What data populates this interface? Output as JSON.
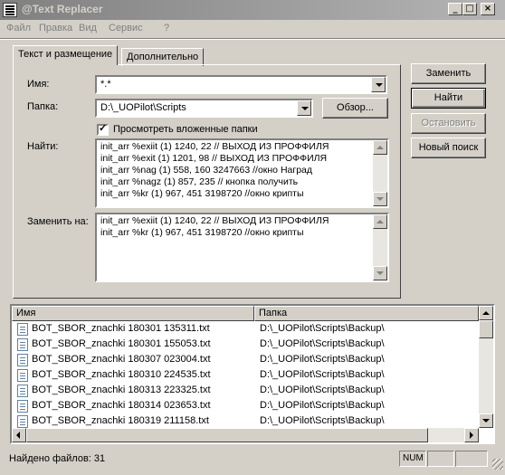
{
  "window": {
    "title": "@Text Replacer"
  },
  "menu": [
    "Файл",
    "Правка",
    "Вид",
    "Сервис",
    "?"
  ],
  "tabs": [
    {
      "label": "Текст и размещение",
      "active": true
    },
    {
      "label": "Дополнительно",
      "active": false
    }
  ],
  "form": {
    "name_label": "Имя:",
    "name_value": "*.*",
    "folder_label": "Папка:",
    "folder_value": "D:\\_UOPilot\\Scripts",
    "browse_button": "Обзор...",
    "subfolders_label": "Просмотреть вложенные папки",
    "subfolders_checked": true,
    "find_label": "Найти:",
    "find_lines": [
      "init_arr %exiit (1) 1240, 22   // ВЫХОД ИЗ ПРОФФИЛЯ",
      "init_arr %exit (1) 1201, 98    // ВЫХОД ИЗ ПРОФФИЛЯ",
      "init_arr %nag (1) 558, 160 3247663 //окно Наград",
      "init_arr %nagz (1) 857, 235 // кнопка получить",
      "init_arr %kr (1) 967, 451 3198720 //окно крипты"
    ],
    "replace_label": "Заменить на:",
    "replace_lines": [
      "init_arr %exiit (1) 1240, 22   // ВЫХОД ИЗ ПРОФФИЛЯ",
      "init_arr %kr (1) 967, 451 3198720 //окно крипты"
    ]
  },
  "actions": {
    "replace": "Заменить",
    "find": "Найти",
    "stop": "Остановить",
    "new_search": "Новый поиск"
  },
  "results": {
    "columns": [
      "Имя",
      "Папка"
    ],
    "rows": [
      {
        "name": "BOT_SBOR_znachki 180301 135311.txt",
        "folder": "D:\\_UOPilot\\Scripts\\Backup\\"
      },
      {
        "name": "BOT_SBOR_znachki 180301 155053.txt",
        "folder": "D:\\_UOPilot\\Scripts\\Backup\\"
      },
      {
        "name": "BOT_SBOR_znachki 180307 023004.txt",
        "folder": "D:\\_UOPilot\\Scripts\\Backup\\"
      },
      {
        "name": "BOT_SBOR_znachki 180310 224535.txt",
        "folder": "D:\\_UOPilot\\Scripts\\Backup\\"
      },
      {
        "name": "BOT_SBOR_znachki 180313 223325.txt",
        "folder": "D:\\_UOPilot\\Scripts\\Backup\\"
      },
      {
        "name": "BOT_SBOR_znachki 180314 023653.txt",
        "folder": "D:\\_UOPilot\\Scripts\\Backup\\"
      },
      {
        "name": "BOT_SBOR_znachki 180319 211158.txt",
        "folder": "D:\\_UOPilot\\Scripts\\Backup\\"
      }
    ]
  },
  "status": {
    "text": "Найдено файлов: 31",
    "num": "NUM"
  }
}
